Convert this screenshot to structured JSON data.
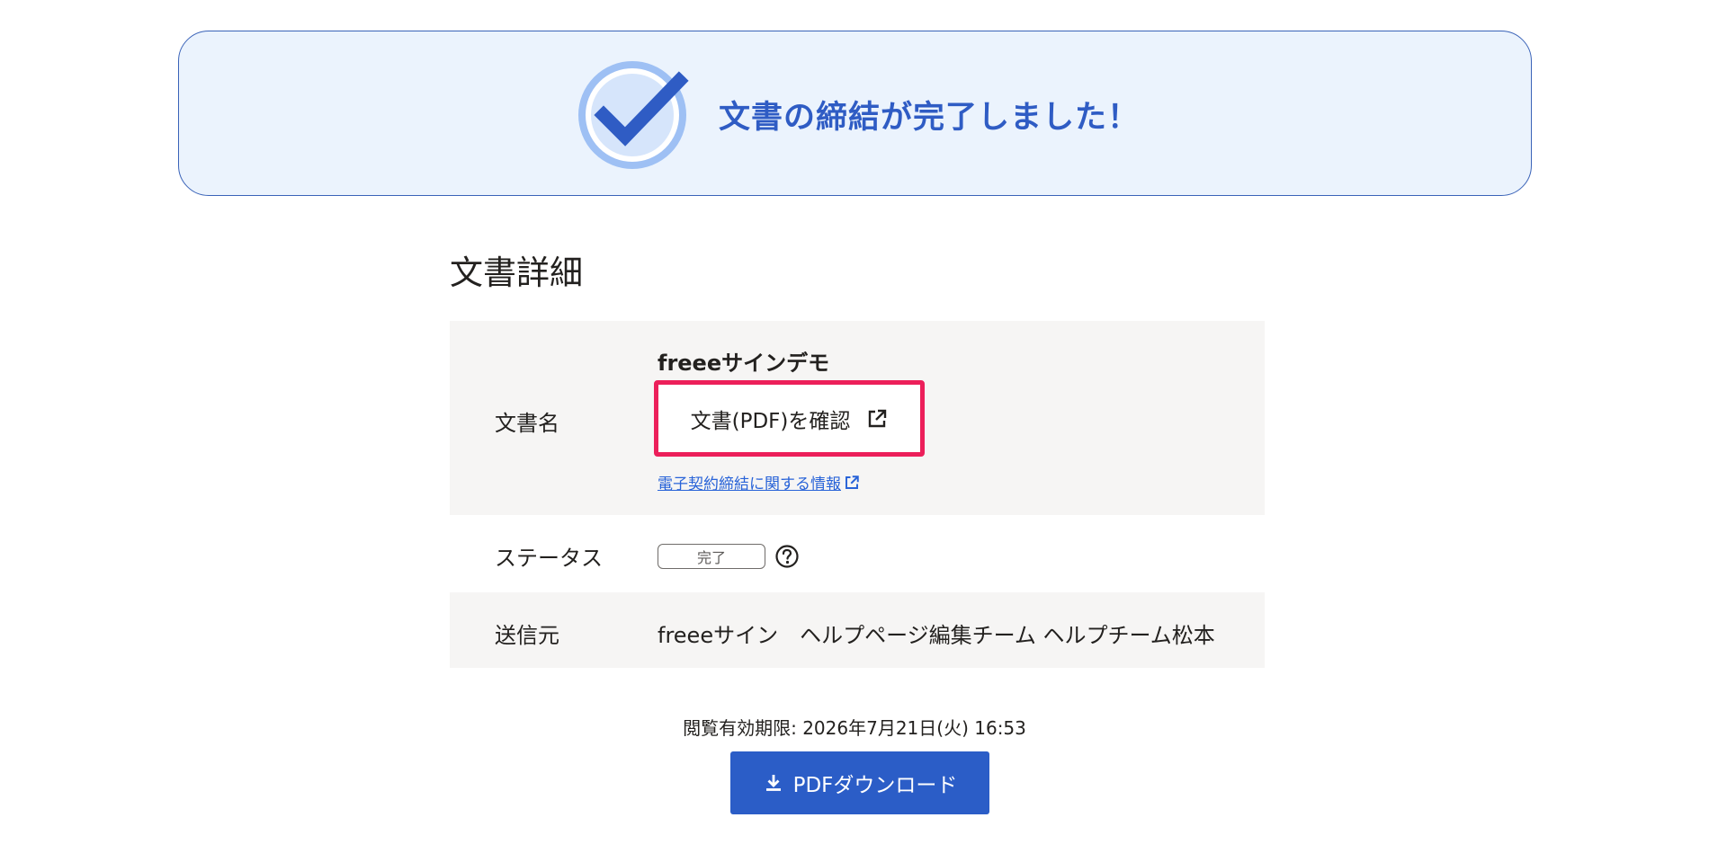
{
  "banner": {
    "title": "文書の締結が完了しました！",
    "icon": "check-circle-icon",
    "accent_color": "#2f5cc4"
  },
  "details": {
    "section_title": "文書詳細",
    "document_row": {
      "label": "文書名",
      "document_name": "freeeサインデモ",
      "view_pdf_label": "文書(PDF)を確認",
      "view_pdf_icon": "external-link-icon",
      "info_link_label": "電子契約締結に関する情報",
      "info_link_icon": "external-link-icon"
    },
    "status_row": {
      "label": "ステータス",
      "status_value": "完了",
      "help_icon": "question-circle-icon"
    },
    "sender_row": {
      "label": "送信元",
      "sender_value": "freeeサイン　ヘルプページ編集チーム ヘルプチーム松本"
    }
  },
  "footer": {
    "expiry_text": "閲覧有効期限: 2026年7月21日(火) 16:53",
    "download_label": "PDFダウンロード",
    "download_icon": "download-icon"
  },
  "colors": {
    "highlight_border": "#ec1f5a",
    "button_blue": "#2b5dc7",
    "link_blue": "#2863d8",
    "row_shade": "#f6f5f4"
  }
}
